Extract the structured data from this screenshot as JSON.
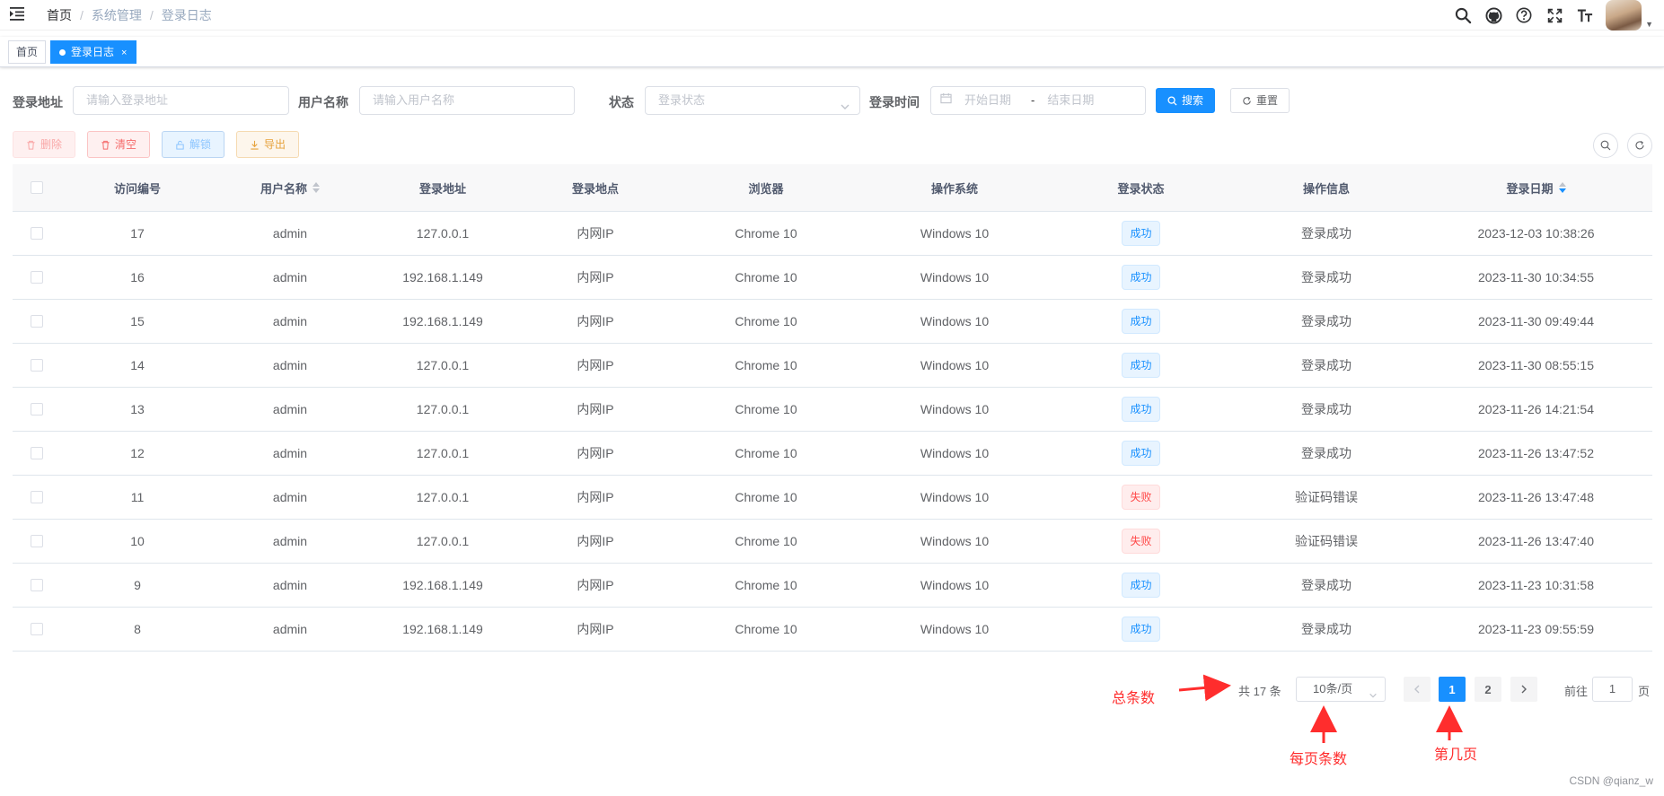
{
  "navbar": {
    "breadcrumb": [
      "首页",
      "系统管理",
      "登录日志"
    ],
    "separator": "/",
    "icons": [
      "search-icon",
      "github-icon",
      "question-icon",
      "fullscreen-icon",
      "font-size-icon"
    ]
  },
  "tags": {
    "items": [
      {
        "label": "首页",
        "active": false
      },
      {
        "label": "登录日志",
        "active": true,
        "close": "×"
      }
    ]
  },
  "search": {
    "ipaddr": {
      "label": "登录地址",
      "placeholder": "请输入登录地址"
    },
    "username": {
      "label": "用户名称",
      "placeholder": "请输入用户名称"
    },
    "status": {
      "label": "状态",
      "placeholder": "登录状态"
    },
    "time": {
      "label": "登录时间",
      "start_placeholder": "开始日期",
      "separator": "-",
      "end_placeholder": "结束日期"
    },
    "search_btn": "搜索",
    "reset_btn": "重置"
  },
  "toolbar": {
    "delete": "删除",
    "clear": "清空",
    "unlock": "解锁",
    "export": "导出"
  },
  "table": {
    "headers": [
      "访问编号",
      "用户名称",
      "登录地址",
      "登录地点",
      "浏览器",
      "操作系统",
      "登录状态",
      "操作信息",
      "登录日期"
    ],
    "rows": [
      {
        "id": "17",
        "user": "admin",
        "ip": "127.0.0.1",
        "loc": "内网IP",
        "browser": "Chrome 10",
        "os": "Windows 10",
        "status": "成功",
        "status_type": "ok",
        "msg": "登录成功",
        "date": "2023-12-03 10:38:26"
      },
      {
        "id": "16",
        "user": "admin",
        "ip": "192.168.1.149",
        "loc": "内网IP",
        "browser": "Chrome 10",
        "os": "Windows 10",
        "status": "成功",
        "status_type": "ok",
        "msg": "登录成功",
        "date": "2023-11-30 10:34:55"
      },
      {
        "id": "15",
        "user": "admin",
        "ip": "192.168.1.149",
        "loc": "内网IP",
        "browser": "Chrome 10",
        "os": "Windows 10",
        "status": "成功",
        "status_type": "ok",
        "msg": "登录成功",
        "date": "2023-11-30 09:49:44"
      },
      {
        "id": "14",
        "user": "admin",
        "ip": "127.0.0.1",
        "loc": "内网IP",
        "browser": "Chrome 10",
        "os": "Windows 10",
        "status": "成功",
        "status_type": "ok",
        "msg": "登录成功",
        "date": "2023-11-30 08:55:15"
      },
      {
        "id": "13",
        "user": "admin",
        "ip": "127.0.0.1",
        "loc": "内网IP",
        "browser": "Chrome 10",
        "os": "Windows 10",
        "status": "成功",
        "status_type": "ok",
        "msg": "登录成功",
        "date": "2023-11-26 14:21:54"
      },
      {
        "id": "12",
        "user": "admin",
        "ip": "127.0.0.1",
        "loc": "内网IP",
        "browser": "Chrome 10",
        "os": "Windows 10",
        "status": "成功",
        "status_type": "ok",
        "msg": "登录成功",
        "date": "2023-11-26 13:47:52"
      },
      {
        "id": "11",
        "user": "admin",
        "ip": "127.0.0.1",
        "loc": "内网IP",
        "browser": "Chrome 10",
        "os": "Windows 10",
        "status": "失败",
        "status_type": "fail",
        "msg": "验证码错误",
        "date": "2023-11-26 13:47:48"
      },
      {
        "id": "10",
        "user": "admin",
        "ip": "127.0.0.1",
        "loc": "内网IP",
        "browser": "Chrome 10",
        "os": "Windows 10",
        "status": "失败",
        "status_type": "fail",
        "msg": "验证码错误",
        "date": "2023-11-26 13:47:40"
      },
      {
        "id": "9",
        "user": "admin",
        "ip": "192.168.1.149",
        "loc": "内网IP",
        "browser": "Chrome 10",
        "os": "Windows 10",
        "status": "成功",
        "status_type": "ok",
        "msg": "登录成功",
        "date": "2023-11-23 10:31:58"
      },
      {
        "id": "8",
        "user": "admin",
        "ip": "192.168.1.149",
        "loc": "内网IP",
        "browser": "Chrome 10",
        "os": "Windows 10",
        "status": "成功",
        "status_type": "ok",
        "msg": "登录成功",
        "date": "2023-11-23 09:55:59"
      }
    ]
  },
  "pagination": {
    "total": "共 17 条",
    "page_size": "10条/页",
    "pages": [
      "1",
      "2"
    ],
    "current": "1",
    "jump_prefix": "前往",
    "jump_value": "1",
    "jump_suffix": "页"
  },
  "annotations": {
    "total": "总条数",
    "page_size": "每页条数",
    "page": "第几页",
    "color": "#ff2d2d"
  },
  "watermark": "CSDN @qianz_w",
  "colors": {
    "primary": "#1890ff",
    "danger": "#f56c6c",
    "warning": "#e6a23c"
  }
}
